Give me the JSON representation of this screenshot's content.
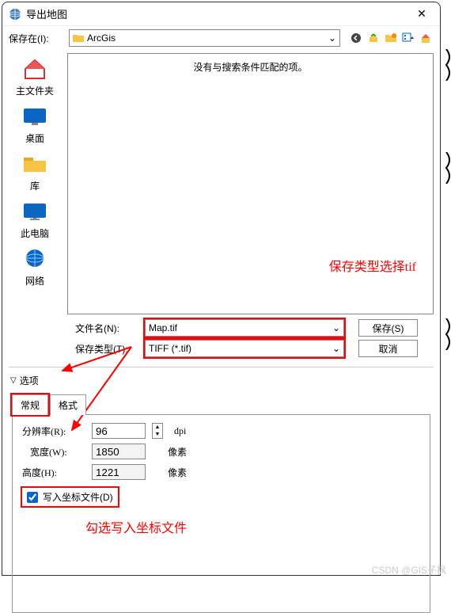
{
  "window": {
    "title": "导出地图"
  },
  "topbar": {
    "save_in_label": "保存在(I):",
    "path_value": "ArcGis"
  },
  "sidebar": {
    "items": [
      {
        "label": "主文件夹"
      },
      {
        "label": "桌面"
      },
      {
        "label": "库"
      },
      {
        "label": "此电脑"
      },
      {
        "label": "网络"
      }
    ]
  },
  "file_pane": {
    "empty_text": "没有与搜索条件匹配的项。"
  },
  "annotations": {
    "save_type_hint": "保存类型选择tif",
    "checkbox_hint": "勾选写入坐标文件"
  },
  "file_fields": {
    "filename_label": "文件名(N):",
    "filename_value": "Map.tif",
    "savetype_label": "保存类型(T):",
    "savetype_value": "TIFF (*.tif)",
    "save_button": "保存(S)",
    "cancel_button": "取消"
  },
  "options": {
    "header": "选项",
    "tabs": [
      {
        "label": "常规",
        "active": true
      },
      {
        "label": "格式",
        "active": false
      }
    ],
    "resolution_label": "分辨率(R):",
    "resolution_value": "96",
    "resolution_unit": "dpi",
    "width_label": "宽度(W):",
    "width_value": "1850",
    "width_unit": "像素",
    "height_label": "高度(H):",
    "height_value": "1221",
    "height_unit": "像素",
    "world_file_label": "写入坐标文件(D)",
    "world_file_checked": true
  },
  "watermark": "CSDN @GIS子枫"
}
